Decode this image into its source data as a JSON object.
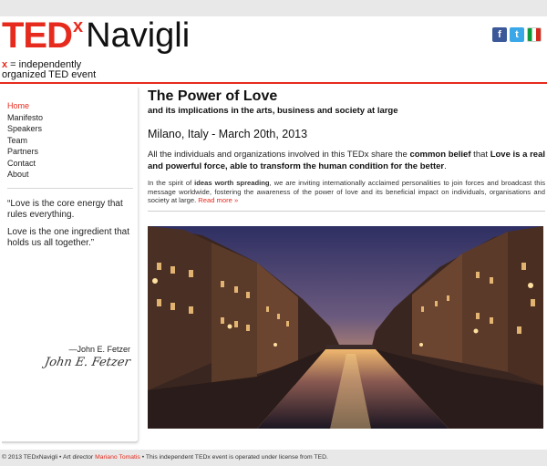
{
  "brand": {
    "ted": "TED",
    "x": "x",
    "name": "Navigli",
    "tagline_x": "x",
    "tagline_eq": " = independently",
    "tagline_line2": "organized TED event"
  },
  "social": [
    {
      "name": "facebook-icon",
      "glyph": "f"
    },
    {
      "name": "twitter-icon",
      "glyph": "t"
    },
    {
      "name": "italian-flag-icon",
      "glyph": ""
    }
  ],
  "nav": [
    {
      "label": "Home",
      "active": true
    },
    {
      "label": "Manifesto"
    },
    {
      "label": "Speakers"
    },
    {
      "label": "Team"
    },
    {
      "label": "Partners"
    },
    {
      "label": "Contact"
    },
    {
      "label": "About"
    }
  ],
  "quote": {
    "line1": "“Love is the core energy that rules everything.",
    "line2": "Love is the one ingredient that holds us all together.”",
    "author": "—John E. Fetzer",
    "signature": "John E. Fetzer"
  },
  "main": {
    "title": "The Power of Love",
    "subtitle": "and its implications in the arts, business and society at large",
    "location": "Milano, Italy - March 20th, 2013",
    "lead_1": "All the individuals and organizations involved in this TEDx share the ",
    "lead_b1": "common belief",
    "lead_2": " that ",
    "lead_b2": "Love is a real and powerful force, able to transform the human condition for the better",
    "lead_3": ".",
    "body_1": "In the spirit of ",
    "body_b": "ideas worth spreading",
    "body_2": ", we are inviting internationally acclaimed personalities to join forces and broadcast this message worldwide, fostering the awareness of the power of love and its beneficial impact on individuals, organisations and society at large. ",
    "read_more": "Read more »"
  },
  "footer": {
    "prefix": "© 2013 TEDxNavigli • Art director ",
    "director": "Mariano Tomatis",
    "suffix": " • This independent TEDx event is operated under license from TED."
  },
  "colors": {
    "brand_red": "#e62b1e",
    "bar_gray": "#e8e8e8"
  }
}
